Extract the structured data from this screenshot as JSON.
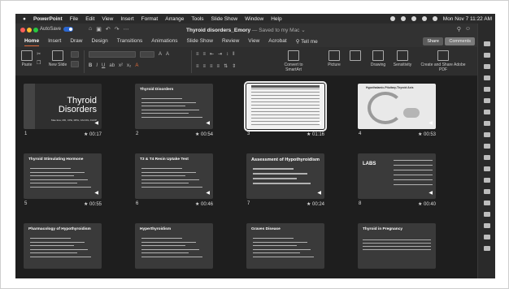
{
  "menubar": {
    "app": "PowerPoint",
    "items": [
      "File",
      "Edit",
      "View",
      "Insert",
      "Format",
      "Arrange",
      "Tools",
      "Slide Show",
      "Window",
      "Help"
    ],
    "datetime": "Mon Nov 7 11:22 AM"
  },
  "titlebar": {
    "autosave": "AutoSave",
    "doc_name": "Thyroid disorders_Emory",
    "saved": " — Saved to my Mac ⌄"
  },
  "tabs": {
    "items": [
      "Home",
      "Insert",
      "Draw",
      "Design",
      "Transitions",
      "Animations",
      "Slide Show",
      "Review",
      "View",
      "Acrobat",
      "Tell me"
    ],
    "active_index": 0,
    "share": "Share",
    "comments": "Comments"
  },
  "ribbon": {
    "paste": "Paste",
    "new_slide": "New Slide",
    "convert": "Convert to SmartArt",
    "picture": "Picture",
    "drawing": "Drawing",
    "sensitivity": "Sensitivity",
    "create_share": "Create and Share Adobe PDF"
  },
  "slides": [
    {
      "num": "1",
      "time": "00:17",
      "title": "Thyroid Disorders",
      "style": "title",
      "subtitle": "Mae Exa, MD, CPE, MPH, FACOG, FACP",
      "selected": false
    },
    {
      "num": "2",
      "time": "00:54",
      "title": "Thyroid Disorders",
      "style": "bullets",
      "selected": false
    },
    {
      "num": "3",
      "time": "01:16",
      "title": "",
      "style": "table",
      "selected": true
    },
    {
      "num": "4",
      "time": "00:53",
      "title": "Hypothalamic-Pituitary-Thyroid Axis",
      "style": "diagram",
      "selected": false
    },
    {
      "num": "5",
      "time": "00:55",
      "title": "Thyroid Stimulating Hormone",
      "style": "bullets",
      "selected": false
    },
    {
      "num": "6",
      "time": "00:46",
      "title": "T3 & T4 Resin Uptake Test",
      "style": "bullets",
      "selected": false
    },
    {
      "num": "7",
      "time": "00:24",
      "title": "Assessment of Hypothyroidism",
      "style": "bullets-big",
      "selected": false
    },
    {
      "num": "8",
      "time": "00:40",
      "title": "LABS",
      "style": "labs",
      "selected": false
    },
    {
      "num": "",
      "time": "",
      "title": "Pharmacology of Hypothyroidism",
      "style": "bullets",
      "selected": false
    },
    {
      "num": "",
      "time": "",
      "title": "Hyperthyroidism",
      "style": "bullets",
      "selected": false
    },
    {
      "num": "",
      "time": "",
      "title": "Graves Disease",
      "style": "bullets",
      "selected": false
    },
    {
      "num": "",
      "time": "",
      "title": "Thyroid in Pregnancy",
      "style": "table",
      "selected": false
    }
  ],
  "colors": {
    "screen_bg": "#1c1c1c",
    "chrome": "#323232",
    "accent": "#e06a3a",
    "slide_bg": "#3a3a3a"
  }
}
